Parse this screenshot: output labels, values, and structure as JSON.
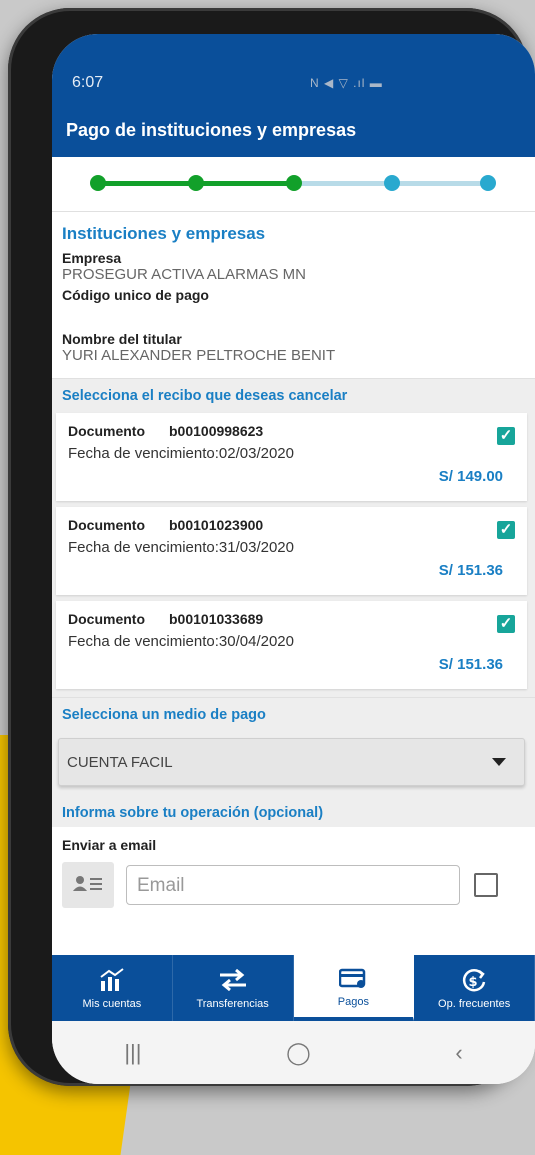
{
  "status": {
    "time": "6:07",
    "icons": "N ◀ ▽ .ıl ▬"
  },
  "appbar": {
    "title": "Pago de instituciones y empresas"
  },
  "stepper": {
    "total": 5,
    "completed": 3
  },
  "institution": {
    "section_title": "Instituciones y empresas",
    "company_label": "Empresa",
    "company_value": "PROSEGUR ACTIVA ALARMAS MN",
    "code_label": "Código unico de pago",
    "holder_label": "Nombre del titular",
    "holder_value": "YURI ALEXANDER PELTROCHE BENIT"
  },
  "receipts": {
    "header": "Selecciona el recibo que deseas cancelar",
    "items": [
      {
        "doc_label": "Documento",
        "doc_number": "b00100998623",
        "due_text": "Fecha de vencimiento:02/03/2020",
        "amount": "S/ 149.00",
        "checked": true
      },
      {
        "doc_label": "Documento",
        "doc_number": "b00101023900",
        "due_text": "Fecha de vencimiento:31/03/2020",
        "amount": "S/ 151.36",
        "checked": true
      },
      {
        "doc_label": "Documento",
        "doc_number": "b00101033689",
        "due_text": "Fecha de vencimiento:30/04/2020",
        "amount": "S/ 151.36",
        "checked": true
      }
    ]
  },
  "payment": {
    "header": "Selecciona un medio de pago",
    "selected": "CUENTA FACIL"
  },
  "info": {
    "header": "Informa sobre tu operación (opcional)",
    "email_label": "Enviar a email",
    "email_placeholder": "Email"
  },
  "nav": {
    "items": [
      {
        "label": "Mis cuentas",
        "icon": "accounts-chart-icon"
      },
      {
        "label": "Transferencias",
        "icon": "transfer-arrows-icon"
      },
      {
        "label": "Pagos",
        "icon": "card-payment-icon",
        "active": true
      },
      {
        "label": "Op. frecuentes",
        "icon": "frequent-ops-icon"
      }
    ]
  },
  "colors": {
    "primary": "#0a4f9a",
    "accent": "#1a7fc4",
    "step_done": "#12a02a",
    "step_pending": "#29a9cf",
    "check": "#17a59a",
    "highlight": "#f5c400"
  }
}
